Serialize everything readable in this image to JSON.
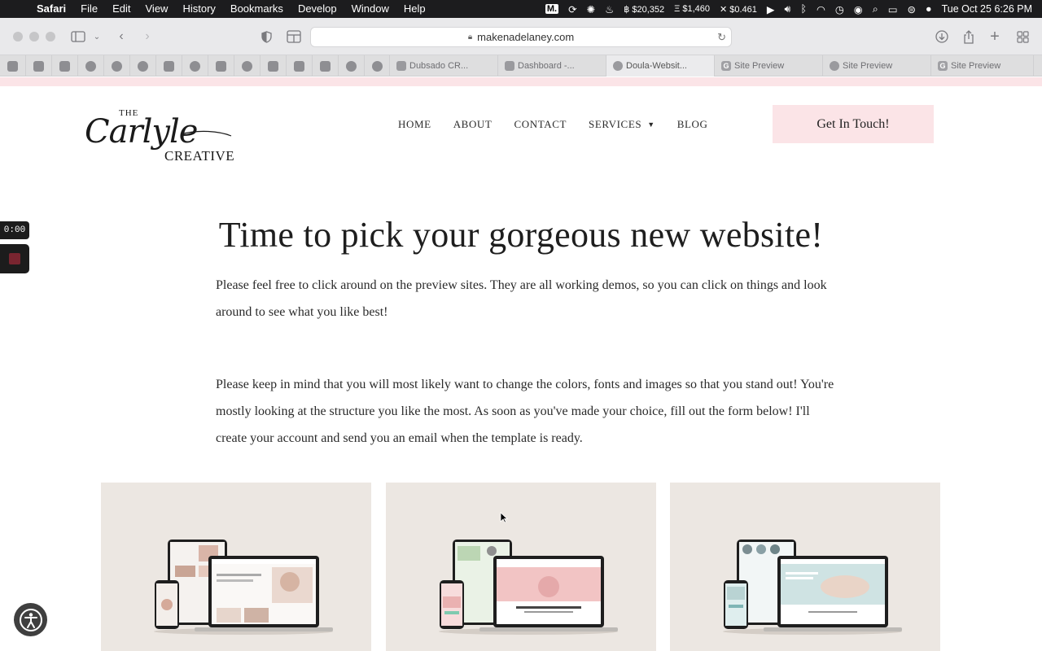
{
  "menubar": {
    "app": "Safari",
    "items": [
      "File",
      "Edit",
      "View",
      "History",
      "Bookmarks",
      "Develop",
      "Window",
      "Help"
    ],
    "ticker_btc": "$20,352",
    "ticker_eth": "$1,460",
    "ticker_xrp": "$0.461",
    "clock": "Tue Oct 25  6:26 PM"
  },
  "browser": {
    "url": "makenadelaney.com",
    "tabs": [
      {
        "label": "Dubsado CR..."
      },
      {
        "label": "Dashboard -..."
      },
      {
        "label": "Doula-Websit..."
      },
      {
        "label": "Site Preview"
      },
      {
        "label": "Site Preview"
      },
      {
        "label": "Site Preview"
      }
    ]
  },
  "site": {
    "logo_the": "THE",
    "logo_script": "Carlyle",
    "logo_creative": "CREATIVE",
    "nav": {
      "home": "HOME",
      "about": "ABOUT",
      "contact": "CONTACT",
      "services": "SERVICES",
      "blog": "BLOG"
    },
    "cta": "Get In Touch!",
    "heading": "Time to pick your gorgeous new website!",
    "para1": "Please feel free to click around on the preview sites. They are all working demos, so you can click on things and look around to see what you like best!",
    "para2": "Please keep in mind that you will most likely want to change the colors, fonts and images so that you stand out! You're mostly looking at the structure you like the most. As soon as you've made your choice, fill out the form below! I'll create your account and send you an email when the template is ready."
  },
  "overlay": {
    "timer": "0:00"
  },
  "colors": {
    "accent_pink": "#fbe4e7",
    "card_bg": "#ece7e2",
    "menubar_bg": "#1c1c1e"
  }
}
